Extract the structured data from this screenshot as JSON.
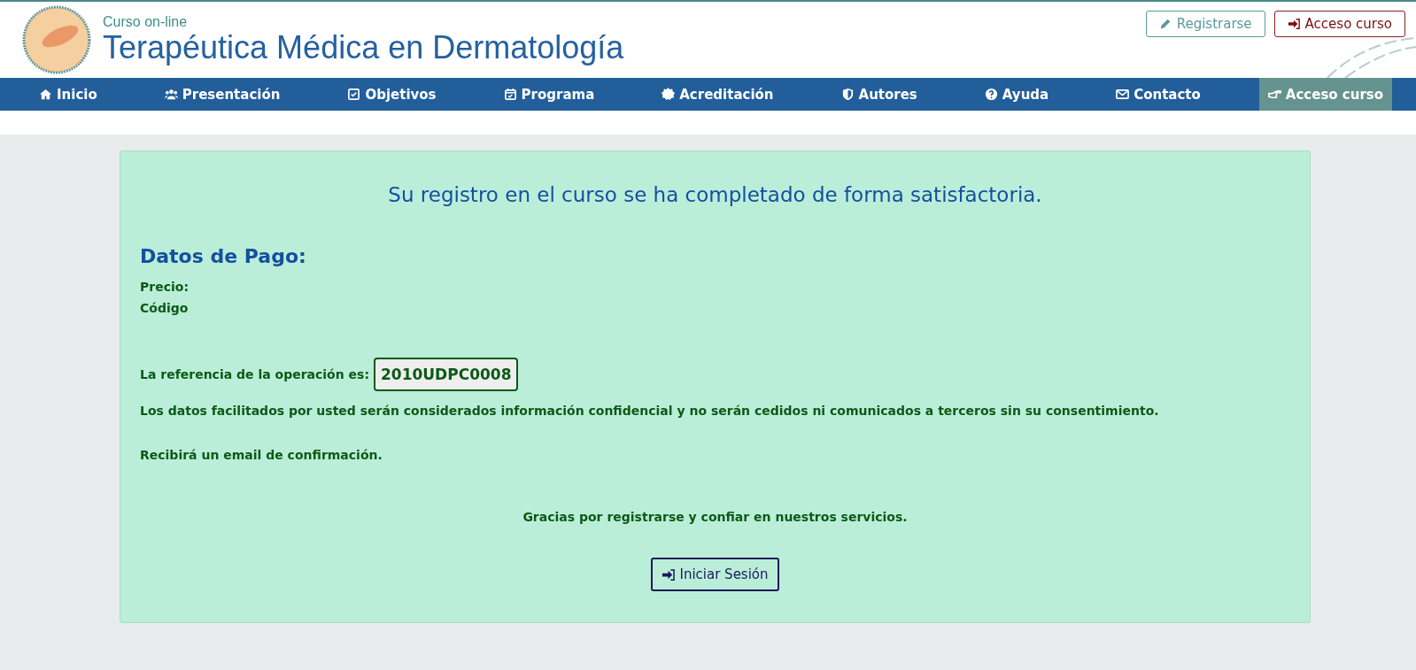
{
  "header": {
    "subtitle": "Curso on-line",
    "title": "Terapéutica Médica en Dermatología",
    "buttons": [
      {
        "label": "Registrarse",
        "kind": "register"
      },
      {
        "label": "Acceso curso",
        "kind": "login"
      }
    ]
  },
  "nav": [
    {
      "label": "Inicio",
      "selected": false
    },
    {
      "label": "Presentación",
      "selected": false
    },
    {
      "label": "Objetivos",
      "selected": false
    },
    {
      "label": "Programa",
      "selected": false
    },
    {
      "label": "Acreditación",
      "selected": false
    },
    {
      "label": "Autores",
      "selected": false
    },
    {
      "label": "Ayuda",
      "selected": false
    },
    {
      "label": "Contacto",
      "selected": false
    },
    {
      "label": "Acceso curso",
      "selected": true
    }
  ],
  "card": {
    "message": "Su registro en el curso se ha completado de forma satisfactoria.",
    "heading": "Datos de Pago:",
    "fields": [
      "Precio:",
      "Código"
    ],
    "reference_label": "La referencia de la operación es:",
    "reference": "2010UDPC0008",
    "privacy": "Los datos facilitados por usted serán considerados información confidencial y no serán cedidos ni comunicados a terceros sin su consentimiento.",
    "confirmation": "Recibirá un email de confirmación.",
    "thanks": "Gracias por registrarse y confiar en nuestros servicios.",
    "button": "Iniciar Sesión"
  }
}
